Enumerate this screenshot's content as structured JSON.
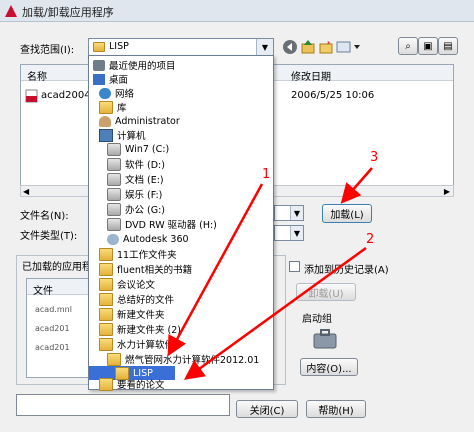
{
  "window": {
    "title": "加载/卸载应用程序",
    "accent": "#ff0000"
  },
  "lookin": {
    "label": "查找范围(I):",
    "value": "LISP"
  },
  "filelist": {
    "col_name": "名称",
    "col_date": "修改日期",
    "row_name": "acad2004",
    "row_date": "2006/5/25 10:06"
  },
  "filename": {
    "label": "文件名(N):"
  },
  "filetype": {
    "label": "文件类型(T):"
  },
  "load_button": {
    "label": "加载(L)"
  },
  "loaded_apps": {
    "title": "已加载的应用程",
    "col_file": "文件",
    "rows": [
      "acad.mnl",
      "acad201",
      "acad201"
    ]
  },
  "history": {
    "label": "添加到历史记录(A)"
  },
  "unload_button": {
    "label": "卸载(U)"
  },
  "startup": {
    "label": "启动组",
    "contents_button": "内容(O)..."
  },
  "close_button": {
    "label": "关闭(C)"
  },
  "help_button": {
    "label": "帮助(H)"
  },
  "dropdown": {
    "items": [
      {
        "label": "最近使用的项目",
        "icon": "recent-icon"
      },
      {
        "label": "桌面",
        "icon": "desktop-icon"
      },
      {
        "label": "网络",
        "icon": "network-icon"
      },
      {
        "label": "库",
        "icon": "library-icon"
      },
      {
        "label": "Administrator",
        "icon": "user-icon"
      },
      {
        "label": "计算机",
        "icon": "computer-icon"
      },
      {
        "label": "Win7 (C:)",
        "icon": "drive-icon"
      },
      {
        "label": "软件 (D:)",
        "icon": "drive-icon"
      },
      {
        "label": "文档 (E:)",
        "icon": "drive-icon"
      },
      {
        "label": "娱乐 (F:)",
        "icon": "drive-icon"
      },
      {
        "label": "办公 (G:)",
        "icon": "drive-icon"
      },
      {
        "label": "DVD RW 驱动器 (H:)",
        "icon": "dvd-icon"
      },
      {
        "label": "Autodesk 360",
        "icon": "cloud-icon"
      },
      {
        "label": "11工作文件夹",
        "icon": "folder-icon"
      },
      {
        "label": "fluent相关的书籍",
        "icon": "folder-icon"
      },
      {
        "label": "会议论文",
        "icon": "folder-icon"
      },
      {
        "label": "总结好的文件",
        "icon": "folder-icon"
      },
      {
        "label": "新建文件夹",
        "icon": "folder-icon"
      },
      {
        "label": "新建文件夹 (2)",
        "icon": "folder-icon"
      },
      {
        "label": "水力计算软件",
        "icon": "folder-icon"
      },
      {
        "label": "燃气管网水力计算软件2012.01",
        "icon": "folder-icon"
      },
      {
        "label": "LISP",
        "icon": "folder-icon"
      },
      {
        "label": "要看的论文",
        "icon": "folder-icon"
      }
    ]
  },
  "annotations": {
    "n1": "1",
    "n2": "2",
    "n3": "3"
  }
}
